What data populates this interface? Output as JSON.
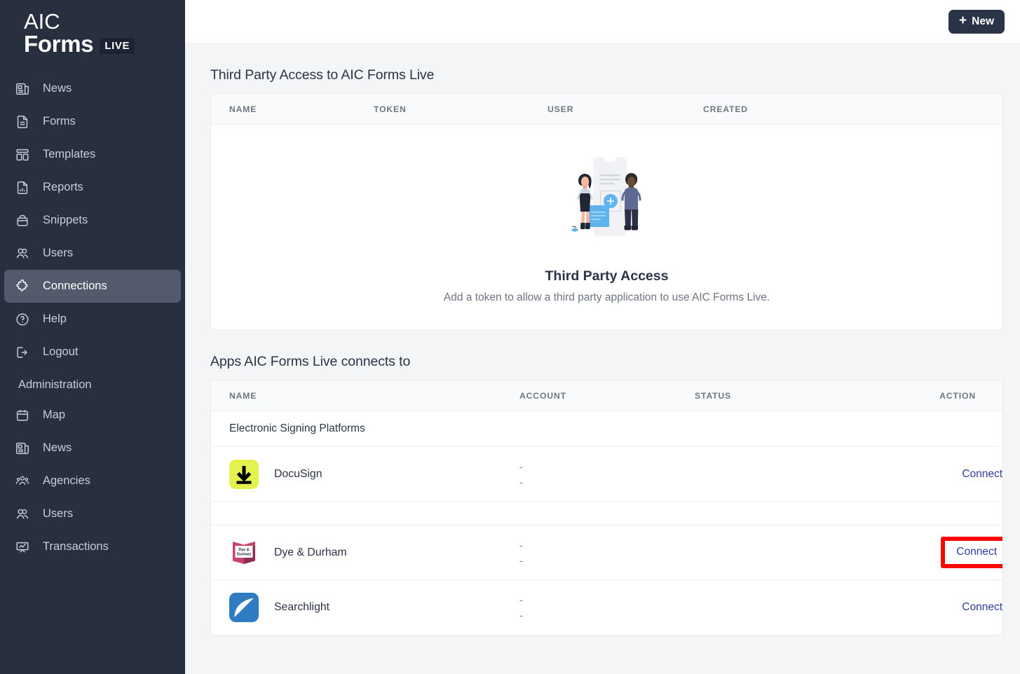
{
  "brand": {
    "line1": "AIC",
    "line2": "Forms",
    "badge": "LIVE"
  },
  "sidebar": {
    "items": [
      {
        "label": "News",
        "icon": "news-icon",
        "active": false
      },
      {
        "label": "Forms",
        "icon": "document-icon",
        "active": false
      },
      {
        "label": "Templates",
        "icon": "templates-icon",
        "active": false
      },
      {
        "label": "Reports",
        "icon": "reports-icon",
        "active": false
      },
      {
        "label": "Snippets",
        "icon": "snippets-icon",
        "active": false
      },
      {
        "label": "Users",
        "icon": "users-icon",
        "active": false
      },
      {
        "label": "Connections",
        "icon": "puzzle-icon",
        "active": true
      },
      {
        "label": "Help",
        "icon": "question-circle-icon",
        "active": false
      },
      {
        "label": "Logout",
        "icon": "logout-icon",
        "active": false
      }
    ],
    "section_label": "Administration",
    "admin_items": [
      {
        "label": "Map",
        "icon": "calendar-icon"
      },
      {
        "label": "News",
        "icon": "news-icon"
      },
      {
        "label": "Agencies",
        "icon": "agencies-icon"
      },
      {
        "label": "Users",
        "icon": "users-icon"
      },
      {
        "label": "Transactions",
        "icon": "transactions-icon"
      }
    ]
  },
  "topbar": {
    "new_label": "New",
    "new_icon": "plus-icon"
  },
  "third_party": {
    "title": "Third Party Access to AIC Forms Live",
    "columns": [
      "NAME",
      "TOKEN",
      "USER",
      "CREATED"
    ],
    "empty": {
      "illustration": "people-with-phone-illustration",
      "title": "Third Party Access",
      "subtitle": "Add a token to allow a third party application to use AIC Forms Live."
    }
  },
  "apps": {
    "title": "Apps AIC Forms Live connects to",
    "columns": [
      "NAME",
      "ACCOUNT",
      "STATUS",
      "ACTION"
    ],
    "group_label": "Electronic Signing Platforms",
    "rows": [
      {
        "name": "DocuSign",
        "icon": "docusign-icon",
        "account_line1": "-",
        "account_line2": "-",
        "status": "",
        "action": "Connect",
        "highlighted": false
      },
      {
        "name": "Dye & Durham",
        "icon": "dye-and-durham-icon",
        "account_line1": "-",
        "account_line2": "-",
        "status": "",
        "action": "Connect",
        "highlighted": true
      },
      {
        "name": "Searchlight",
        "icon": "searchlight-icon",
        "account_line1": "-",
        "account_line2": "-",
        "status": "",
        "action": "Connect",
        "highlighted": false
      }
    ]
  },
  "colors": {
    "sidebar_bg": "#282f3f",
    "sidebar_active": "#525a6b",
    "page_bg": "#f4f5f7",
    "accent_link": "#2f3c9e",
    "highlight_border": "#fc0505",
    "docusign_yellow": "#e3f24d",
    "dye_durham_pink": "#c8446c",
    "searchlight_blue": "#2f7cc3"
  }
}
